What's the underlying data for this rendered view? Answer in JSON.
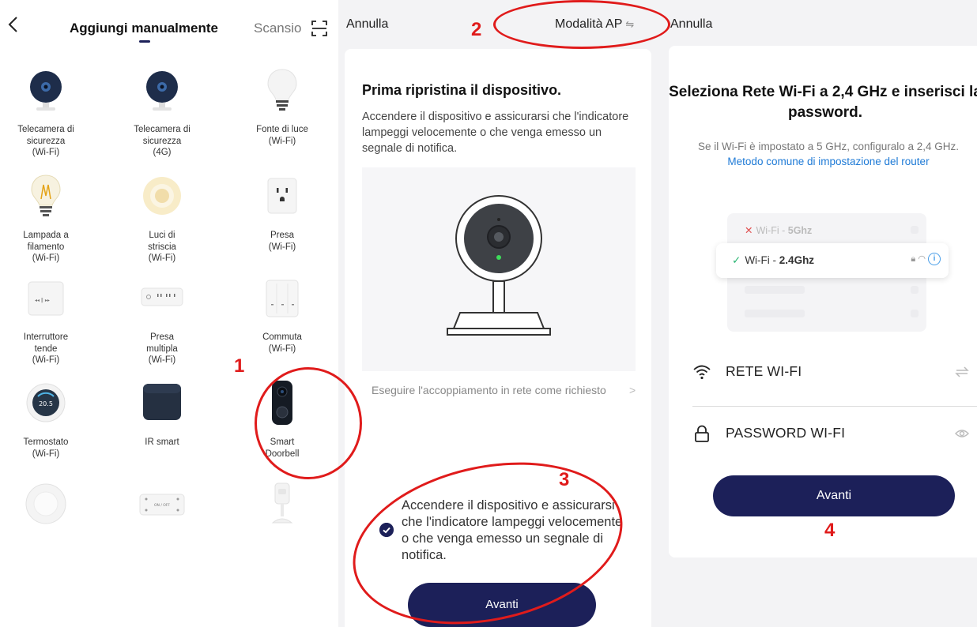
{
  "catalog": {
    "title": "Aggiungi manualmente",
    "scan_tab": "Scansio",
    "devices": [
      {
        "label": "Telecamera di\nsicurezza\n(Wi-Fi)",
        "icon": "security-camera-icon"
      },
      {
        "label": "Telecamera di\nsicurezza\n(4G)",
        "icon": "security-camera-4g-icon"
      },
      {
        "label": "Fonte di luce\n(Wi-Fi)",
        "icon": "light-bulb-icon"
      },
      {
        "label": "Lampada a\nfilamento\n(Wi-Fi)",
        "icon": "filament-bulb-icon"
      },
      {
        "label": "Luci di\nstriscia\n(Wi-Fi)",
        "icon": "light-strip-icon"
      },
      {
        "label": "Presa\n(Wi-Fi)",
        "icon": "socket-icon"
      },
      {
        "label": "Interruttore\ntende\n(Wi-Fi)",
        "icon": "curtain-switch-icon"
      },
      {
        "label": "Presa\nmultipla\n(Wi-Fi)",
        "icon": "power-strip-icon"
      },
      {
        "label": "Commuta\n(Wi-Fi)",
        "icon": "wall-switch-icon"
      },
      {
        "label": "Termostato\n(Wi-Fi)",
        "icon": "thermostat-icon",
        "display": "20.5"
      },
      {
        "label": "IR smart",
        "icon": "ir-remote-icon"
      },
      {
        "label": "Smart\nDoorbell",
        "icon": "doorbell-icon"
      },
      {
        "label": "",
        "icon": "smoke-detector-icon"
      },
      {
        "label": "",
        "icon": "breaker-icon",
        "display": "ON / OFF"
      },
      {
        "label": "",
        "icon": "motion-sensor-icon"
      }
    ]
  },
  "reset": {
    "cancel": "Annulla",
    "mode": "Modalità AP",
    "heading": "Prima ripristina il dispositivo.",
    "description": "Accendere il dispositivo e assicurarsi che l'indicatore lampeggi velocemente o che venga emesso un segnale di notifica.",
    "link": "Eseguire l'accoppiamento in rete come richiesto",
    "confirm": "Accendere il dispositivo e assicurarsi che l'indicatore lampeggi velocemente o che venga emesso un segnale di notifica.",
    "confirm_checked": true,
    "next": "Avanti"
  },
  "wifi": {
    "cancel": "Annulla",
    "heading": "Seleziona Rete Wi-Fi a 2,4 GHz e inserisci la password.",
    "description": "Se il Wi-Fi è impostato a 5 GHz, configuralo a 2,4 GHz.",
    "link": "Metodo comune di impostazione del router",
    "illustration": {
      "row_5ghz_prefix": "Wi-Fi - ",
      "row_5ghz_band": "5Ghz",
      "row_24ghz_prefix": "Wi-Fi - ",
      "row_24ghz_band": "2.4Ghz"
    },
    "network_field": "RETE WI-FI",
    "password_field": "PASSWORD WI-FI",
    "next": "Avanti"
  },
  "annotations": [
    "1",
    "2",
    "3",
    "4"
  ],
  "colors": {
    "primary": "#1c2059",
    "annotation": "#e01b1b",
    "link": "#1e7ad6",
    "success": "#2bb673"
  }
}
